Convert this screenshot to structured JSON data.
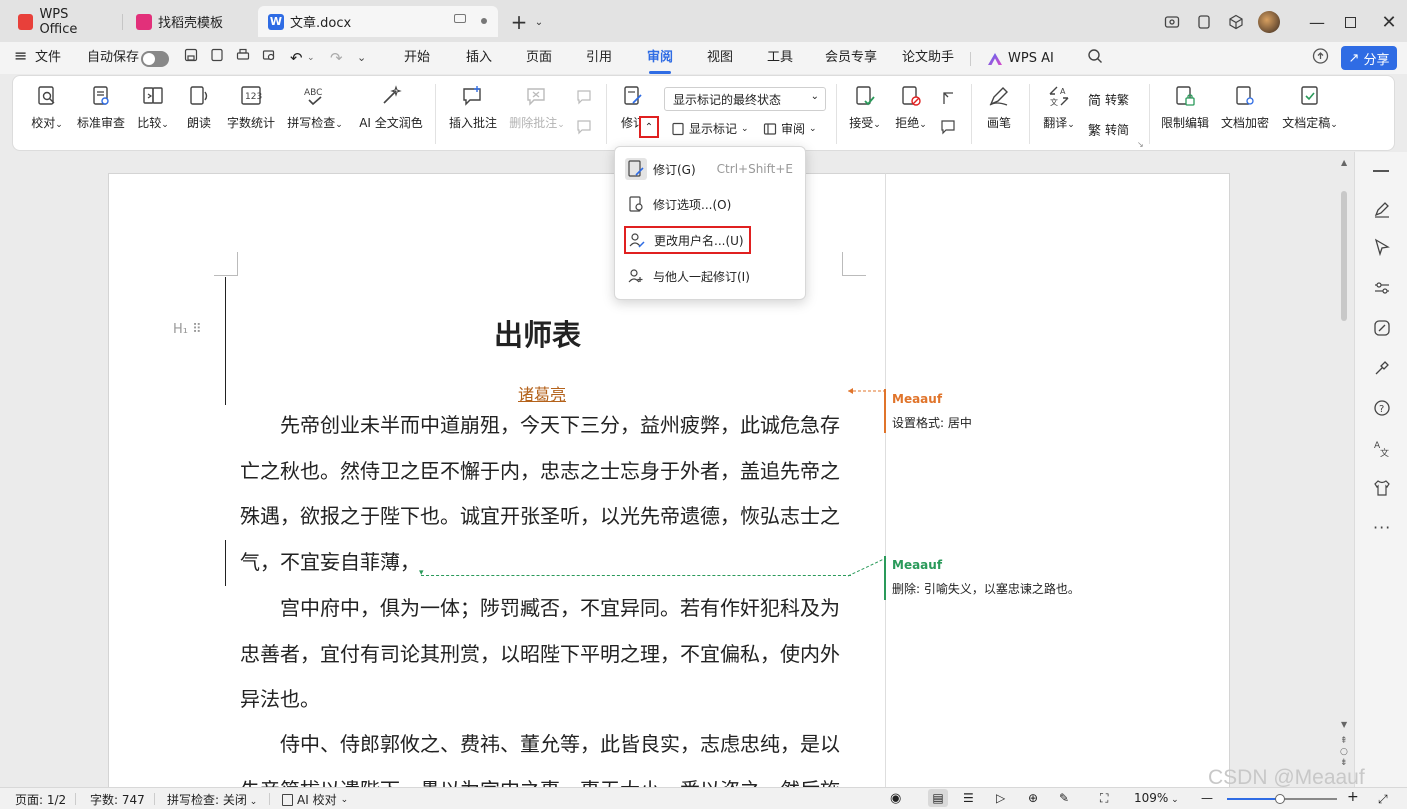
{
  "tabs": [
    {
      "label": "WPS Office"
    },
    {
      "label": "找稻壳模板"
    },
    {
      "label": "文章.docx"
    }
  ],
  "menubar": {
    "file": "文件",
    "autosave": "自动保存",
    "items": [
      "开始",
      "插入",
      "页面",
      "引用",
      "审阅",
      "视图",
      "工具",
      "会员专享",
      "论文助手"
    ],
    "active": "审阅",
    "wps_ai": "WPS AI",
    "share": "分享"
  },
  "ribbon": {
    "proofread": "校对",
    "std_review": "标准审查",
    "compare": "比较",
    "read_aloud": "朗读",
    "word_count": "字数统计",
    "spell_check": "拼写检查",
    "ai_polish": "AI 全文润色",
    "insert_comment": "插入批注",
    "delete_comment": "删除批注",
    "track": "修订",
    "display_state": "显示标记的最终状态",
    "show_markup": "显示标记",
    "review": "审阅",
    "accept": "接受",
    "reject": "拒绝",
    "ink": "画笔",
    "translate": "翻译",
    "to_trad": "转繁",
    "to_simp": "转简",
    "restrict": "限制编辑",
    "encrypt": "文档加密",
    "finalize": "文档定稿"
  },
  "dropdown": {
    "item1": "修订(G)",
    "item1_shortcut": "Ctrl+Shift+E",
    "item2": "修订选项...(O)",
    "item3": "更改用户名...(U)",
    "item4": "与他人一起修订(I)"
  },
  "document": {
    "title": "出师表",
    "author": "诸葛亮",
    "p1_l1": "先帝创业未半而中道崩殂，今天下三分，益州疲弊，此诚危急存",
    "p1_l2": "亡之秋也。然侍卫之臣不懈于内，忠志之士忘身于外者，盖追先帝之",
    "p1_l3": "殊遇，欲报之于陛下也。诚宜开张圣听，以光先帝遗德，恢弘志士之",
    "p1_l4": "气，不宜妄自菲薄，",
    "p2_l1": "宫中府中，俱为一体；陟罚臧否，不宜异同。若有作奸犯科及为",
    "p2_l2": "忠善者，宜付有司论其刑赏，以昭陛下平明之理，不宜偏私，使内外",
    "p2_l3": "异法也。",
    "p3_l1": "侍中、侍郎郭攸之、费祎、董允等，此皆良实，志虑忠纯，是以",
    "p3_l2": "先帝简拔以遗陛下。愚以为宫中之事，事无大小，悉以咨之，然后施"
  },
  "comments": [
    {
      "user": "Meaauf",
      "text": "设置格式: 居中",
      "color": "#e0742b"
    },
    {
      "user": "Meaauf",
      "text": "删除: 引喻失义，以塞忠谏之路也。",
      "color": "#2a9a5a"
    }
  ],
  "status": {
    "page": "页面: 1/2",
    "words": "字数: 747",
    "spell": "拼写检查: 关闭",
    "ai_check": "AI 校对",
    "zoom": "109%",
    "watermark": "CSDN @Meaauf"
  },
  "colors": {
    "accent": "#2f6ce4",
    "highlight_red": "#e02020"
  }
}
